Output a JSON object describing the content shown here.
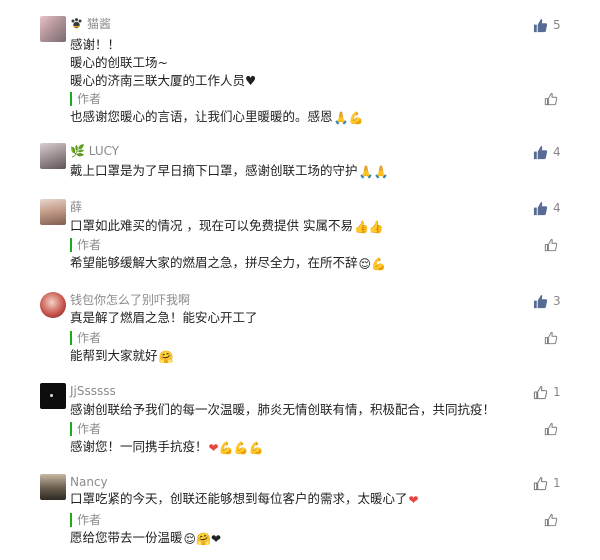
{
  "colors": {
    "accent_green": "#1aad19",
    "like_filled": "#576b95",
    "meta_gray": "#8b8b8b"
  },
  "comments": [
    {
      "nickname": "猫酱",
      "badge_icon": "pet-paw-icon",
      "likes": "5",
      "liked": true,
      "lines": [
        "感谢！！",
        "暖心的创联工场~",
        "暖心的济南三联大厦的工作人员♥"
      ],
      "reply_author_label": "作者",
      "reply_text": "也感谢您暖心的言语，让我们心里暖暖的。感恩",
      "reply_emoji": "🙏💪"
    },
    {
      "nickname": "🌿 LUCY",
      "likes": "4",
      "liked": true,
      "lines": [
        "戴上口罩是为了早日摘下口罩，感谢创联工场的守护"
      ],
      "line_emoji": "🙏🙏"
    },
    {
      "nickname": "薛",
      "likes": "4",
      "liked": true,
      "lines": [
        "口罩如此难买的情况  ，现在可以免费提供 实属不易"
      ],
      "line_emoji": "👍👍",
      "reply_author_label": "作者",
      "reply_text": "希望能够缓解大家的燃眉之急，拼尽全力，在所不辞",
      "reply_emoji": "😌💪"
    },
    {
      "nickname": "钱包你怎么了别吓我啊",
      "likes": "3",
      "liked": true,
      "lines": [
        "真是解了燃眉之急！能安心开工了"
      ],
      "reply_author_label": "作者",
      "reply_text": "能帮到大家就好",
      "reply_emoji": "🤗"
    },
    {
      "nickname": "JjSsssss",
      "likes": "1",
      "liked": false,
      "lines": [
        "感谢创联给予我们的每一次温暖，肺炎无情创联有情，积极配合，共同抗疫！"
      ],
      "reply_author_label": "作者",
      "reply_text": "感谢您！一同携手抗疫！",
      "reply_emoji": "❤💪💪💪"
    },
    {
      "nickname": "Nancy",
      "likes": "1",
      "liked": false,
      "lines": [
        "口罩吃紧的今天，创联还能够想到每位客户的需求，太暖心了"
      ],
      "line_emoji": "❤",
      "reply_author_label": "作者",
      "reply_text": "愿给您带去一份温暖",
      "reply_emoji": "😌🤗❤"
    }
  ]
}
